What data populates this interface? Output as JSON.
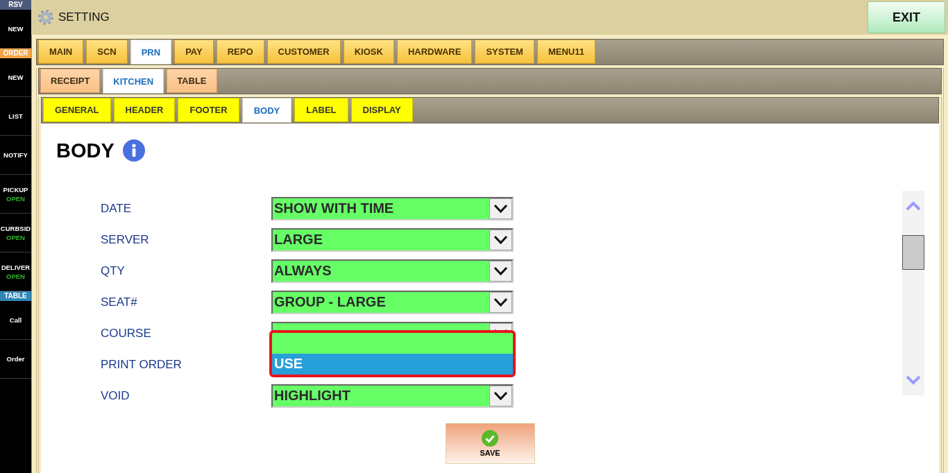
{
  "sidebar": {
    "sections": [
      {
        "header": "RSV",
        "color": "#4b5a7a",
        "items": [
          {
            "label": "NEW"
          }
        ]
      },
      {
        "header": "ORDER",
        "color": "#f5a347",
        "items": [
          {
            "label": "NEW"
          },
          {
            "label": "LIST"
          },
          {
            "label": "NOTIFY"
          },
          {
            "label": "PICKUP",
            "status": "OPEN"
          },
          {
            "label": "CURBSID",
            "status": "OPEN"
          },
          {
            "label": "DELIVER",
            "status": "OPEN"
          }
        ]
      },
      {
        "header": "TABLE",
        "color": "#2f86b6",
        "items": [
          {
            "label": "Call"
          },
          {
            "label": "Order"
          }
        ]
      }
    ]
  },
  "header": {
    "title": "SETTING",
    "exit_label": "EXIT"
  },
  "tabs": [
    {
      "label": "MAIN",
      "selected": false
    },
    {
      "label": "SCN",
      "selected": false
    },
    {
      "label": "PRN",
      "selected": true
    },
    {
      "label": "PAY",
      "selected": false
    },
    {
      "label": "REPO",
      "selected": false
    },
    {
      "label": "CUSTOMER",
      "selected": false
    },
    {
      "label": "KIOSK",
      "selected": false
    },
    {
      "label": "HARDWARE",
      "selected": false
    },
    {
      "label": "SYSTEM",
      "selected": false
    },
    {
      "label": "MENU11",
      "selected": false
    }
  ],
  "subtabs": [
    {
      "label": "RECEIPT",
      "selected": false
    },
    {
      "label": "KITCHEN",
      "selected": true
    },
    {
      "label": "TABLE",
      "selected": false
    }
  ],
  "section_tabs": [
    {
      "label": "GENERAL",
      "selected": false
    },
    {
      "label": "HEADER",
      "selected": false
    },
    {
      "label": "FOOTER",
      "selected": false
    },
    {
      "label": "BODY",
      "selected": true
    },
    {
      "label": "LABEL",
      "selected": false
    },
    {
      "label": "DISPLAY",
      "selected": false
    }
  ],
  "page": {
    "title": "BODY"
  },
  "fields": [
    {
      "label": "DATE",
      "value": "SHOW WITH TIME",
      "open": false
    },
    {
      "label": "SERVER",
      "value": "LARGE",
      "open": false
    },
    {
      "label": "QTY",
      "value": "ALWAYS",
      "open": false
    },
    {
      "label": "SEAT#",
      "value": "GROUP - LARGE",
      "open": false
    },
    {
      "label": "COURSE",
      "open": false
    },
    {
      "label": "PRINT ORDER",
      "open": true,
      "options": [
        {
          "label": "USE",
          "selected": true
        }
      ]
    },
    {
      "label": "VOID",
      "value": "HIGHLIGHT",
      "open": false
    }
  ],
  "save_label": "SAVE"
}
